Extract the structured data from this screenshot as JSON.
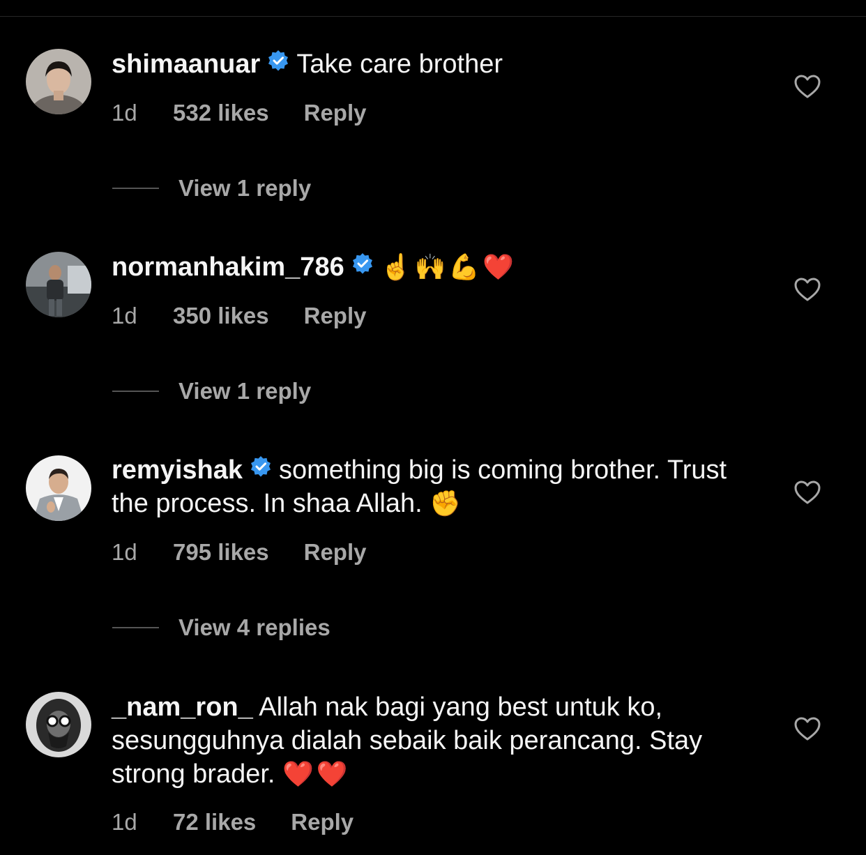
{
  "colors": {
    "background": "#000000",
    "text_primary": "#f5f5f5",
    "text_secondary": "#a8a8a8",
    "verified_badge": "#3897f0",
    "divider": "#555555"
  },
  "comments": [
    {
      "username": "shimaanuar",
      "verified": true,
      "text": "Take care brother",
      "emoji": "",
      "time": "1d",
      "likes": "532 likes",
      "reply_label": "Reply",
      "view_replies": "View 1 reply",
      "icon": "heart-outline-icon"
    },
    {
      "username": "normanhakim_786",
      "verified": true,
      "text": "",
      "emoji": "☝️🙌💪❤️",
      "time": "1d",
      "likes": "350 likes",
      "reply_label": "Reply",
      "view_replies": "View 1 reply",
      "icon": "heart-outline-icon"
    },
    {
      "username": "remyishak",
      "verified": true,
      "text": "something big is coming brother. Trust the process. In shaa Allah.",
      "emoji": "✊",
      "time": "1d",
      "likes": "795 likes",
      "reply_label": "Reply",
      "view_replies": "View 4 replies",
      "icon": "heart-outline-icon"
    },
    {
      "username": "_nam_ron_",
      "verified": false,
      "text": "Allah nak bagi yang best untuk ko, sesungguhnya dialah sebaik baik perancang. Stay strong brader.",
      "emoji": "❤️❤️",
      "time": "1d",
      "likes": "72 likes",
      "reply_label": "Reply",
      "view_replies": "",
      "icon": "heart-outline-icon"
    }
  ]
}
